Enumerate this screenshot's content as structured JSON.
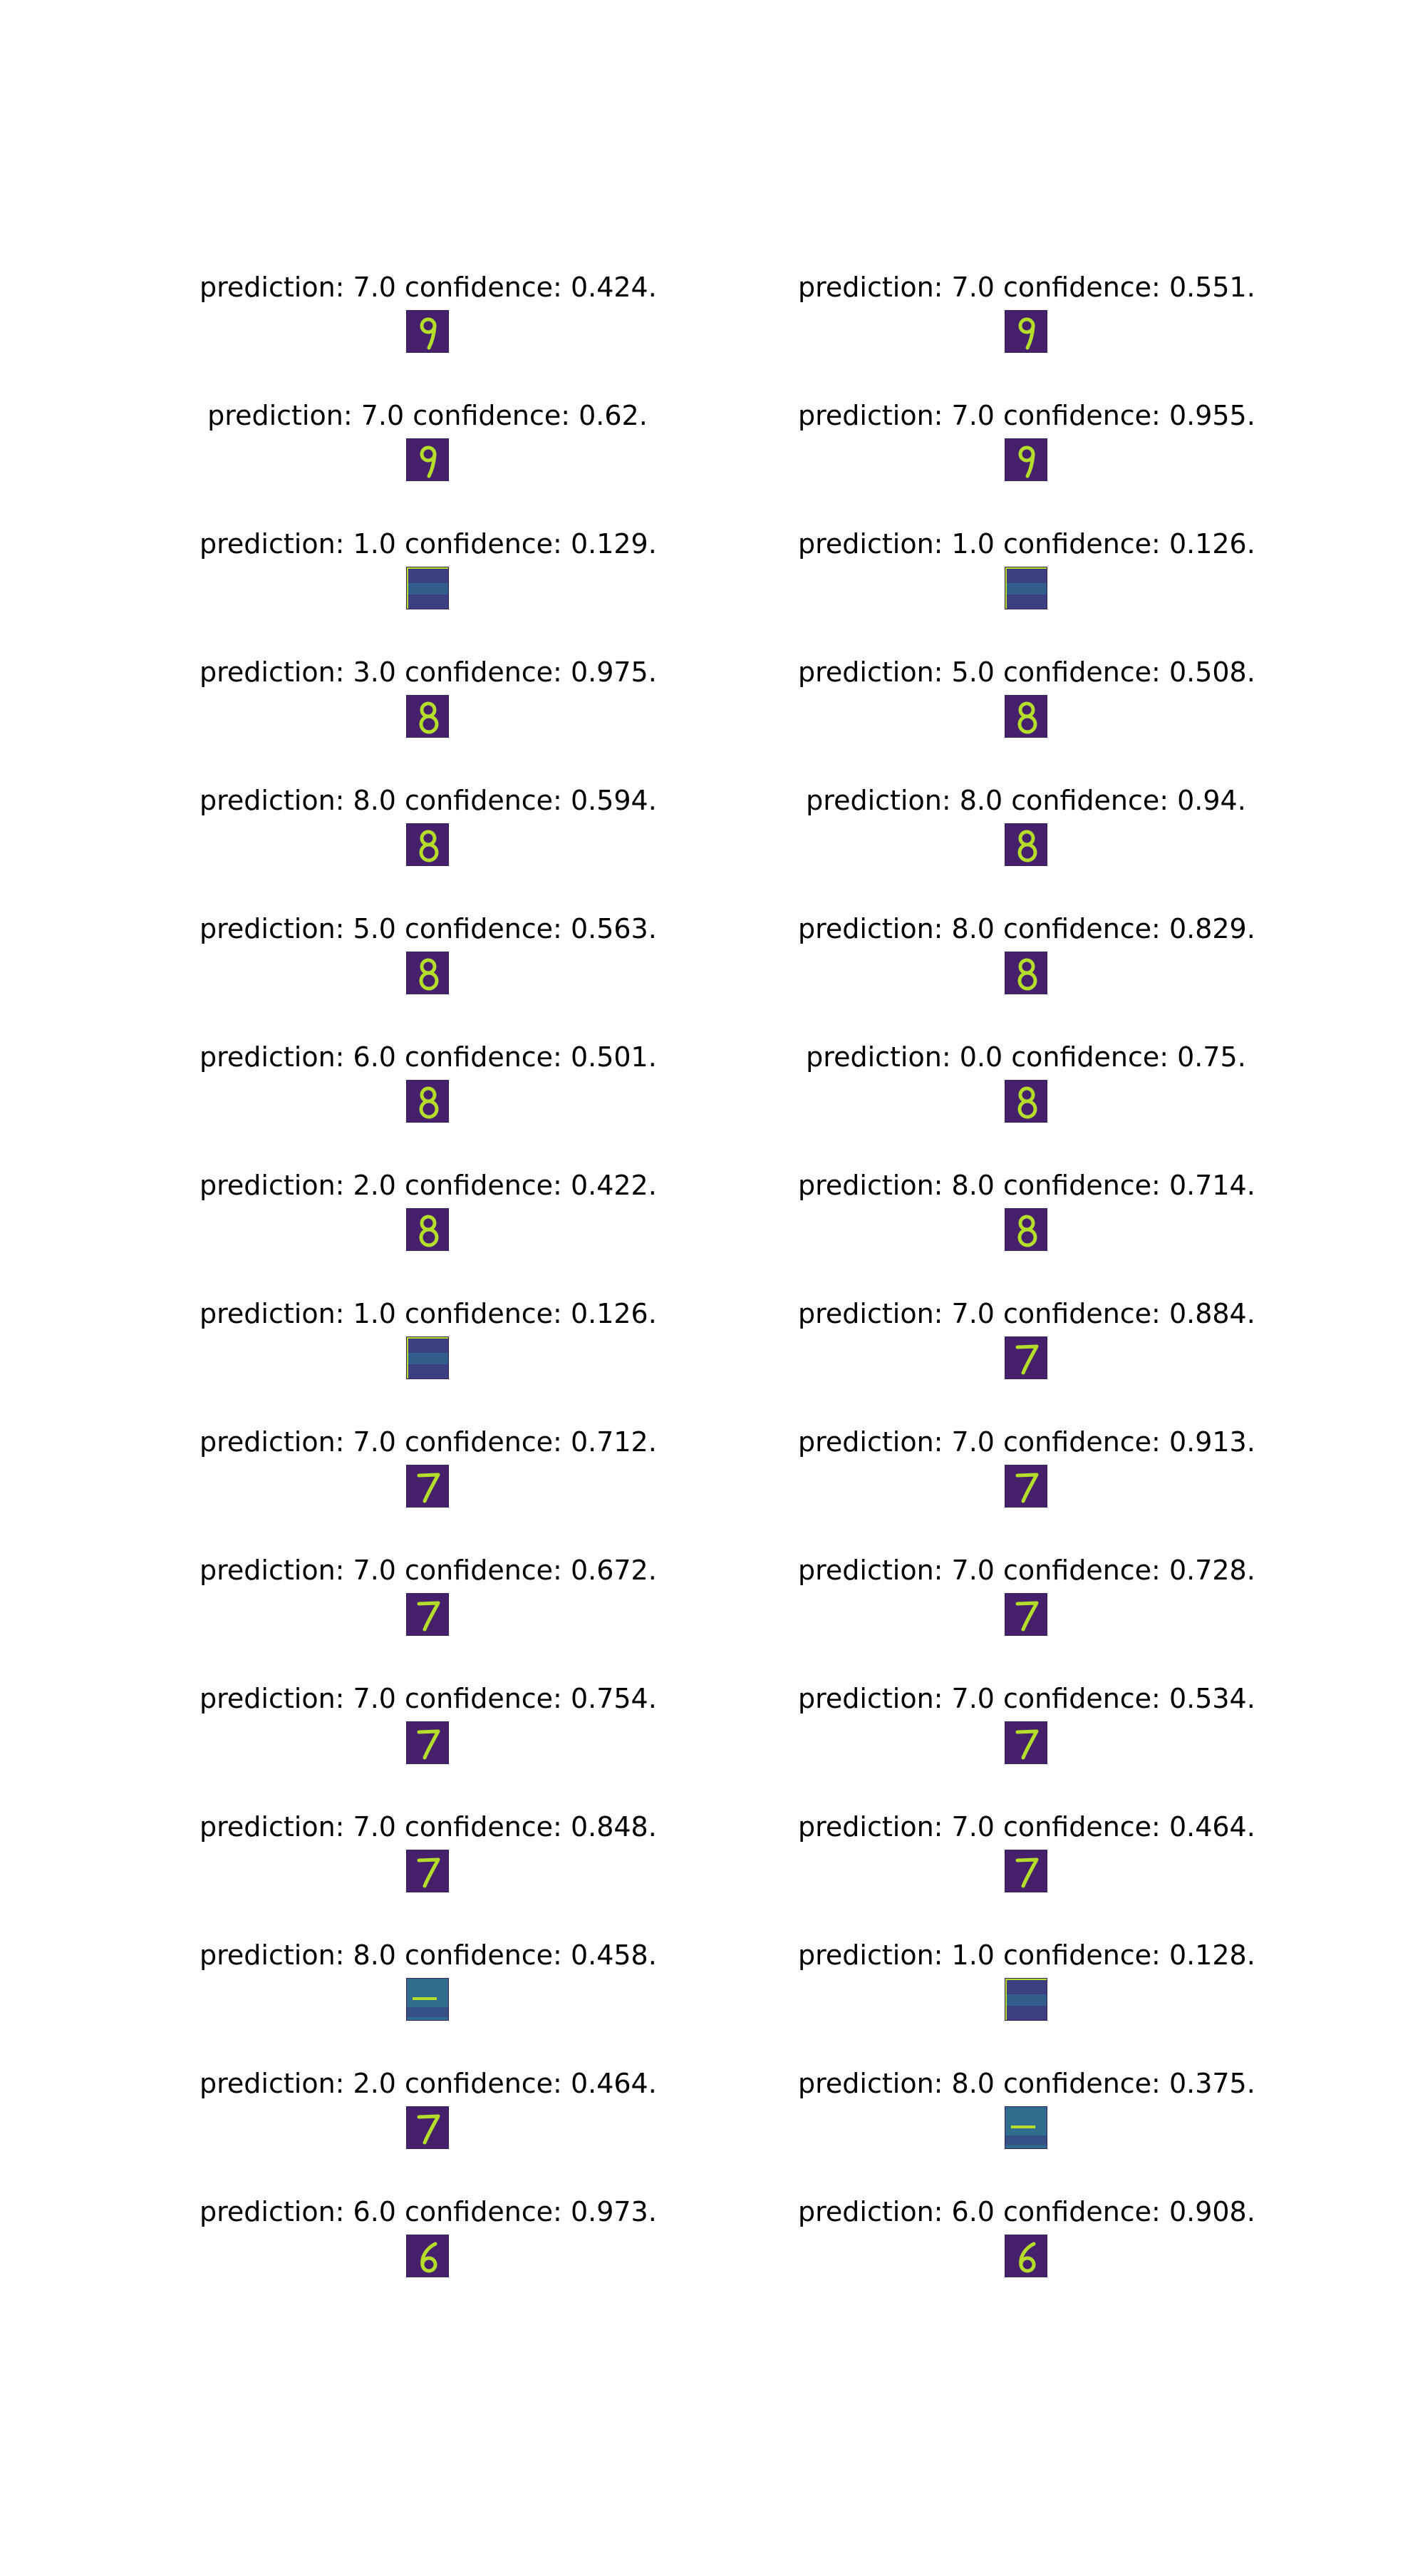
{
  "figure": {
    "columns": 2,
    "rows": 16,
    "panels": [
      {
        "title": "prediction: 7.0 confidence: 0.424.",
        "image": "digit-9"
      },
      {
        "title": "prediction: 7.0 confidence: 0.551.",
        "image": "digit-9"
      },
      {
        "title": "prediction: 7.0 confidence: 0.62.",
        "image": "digit-9"
      },
      {
        "title": "prediction: 7.0 confidence: 0.955.",
        "image": "digit-9"
      },
      {
        "title": "prediction: 1.0 confidence: 0.129.",
        "image": "noise"
      },
      {
        "title": "prediction: 1.0 confidence: 0.126.",
        "image": "noise"
      },
      {
        "title": "prediction: 3.0 confidence: 0.975.",
        "image": "digit-8"
      },
      {
        "title": "prediction: 5.0 confidence: 0.508.",
        "image": "digit-8"
      },
      {
        "title": "prediction: 8.0 confidence: 0.594.",
        "image": "digit-8"
      },
      {
        "title": "prediction: 8.0 confidence: 0.94.",
        "image": "digit-8"
      },
      {
        "title": "prediction: 5.0 confidence: 0.563.",
        "image": "digit-8"
      },
      {
        "title": "prediction: 8.0 confidence: 0.829.",
        "image": "digit-8"
      },
      {
        "title": "prediction: 6.0 confidence: 0.501.",
        "image": "digit-8"
      },
      {
        "title": "prediction: 0.0 confidence: 0.75.",
        "image": "digit-8"
      },
      {
        "title": "prediction: 2.0 confidence: 0.422.",
        "image": "digit-8"
      },
      {
        "title": "prediction: 8.0 confidence: 0.714.",
        "image": "digit-8"
      },
      {
        "title": "prediction: 1.0 confidence: 0.126.",
        "image": "noise"
      },
      {
        "title": "prediction: 7.0 confidence: 0.884.",
        "image": "digit-7"
      },
      {
        "title": "prediction: 7.0 confidence: 0.712.",
        "image": "digit-7"
      },
      {
        "title": "prediction: 7.0 confidence: 0.913.",
        "image": "digit-7"
      },
      {
        "title": "prediction: 7.0 confidence: 0.672.",
        "image": "digit-7"
      },
      {
        "title": "prediction: 7.0 confidence: 0.728.",
        "image": "digit-7"
      },
      {
        "title": "prediction: 7.0 confidence: 0.754.",
        "image": "digit-7"
      },
      {
        "title": "prediction: 7.0 confidence: 0.534.",
        "image": "digit-7"
      },
      {
        "title": "prediction: 7.0 confidence: 0.848.",
        "image": "digit-7"
      },
      {
        "title": "prediction: 7.0 confidence: 0.464.",
        "image": "digit-7"
      },
      {
        "title": "prediction: 8.0 confidence: 0.458.",
        "image": "noise-streak"
      },
      {
        "title": "prediction: 1.0 confidence: 0.128.",
        "image": "noise"
      },
      {
        "title": "prediction: 2.0 confidence: 0.464.",
        "image": "digit-7"
      },
      {
        "title": "prediction: 8.0 confidence: 0.375.",
        "image": "noise-streak"
      },
      {
        "title": "prediction: 6.0 confidence: 0.973.",
        "image": "digit-6"
      },
      {
        "title": "prediction: 6.0 confidence: 0.908.",
        "image": "digit-6"
      }
    ]
  },
  "colors": {
    "background": "#ffffff",
    "text": "#000000",
    "image_background": "#46206b",
    "image_stroke": "#b5de2b",
    "noise_background": "#3b3f80",
    "noise_band": "#2f6d8e"
  }
}
